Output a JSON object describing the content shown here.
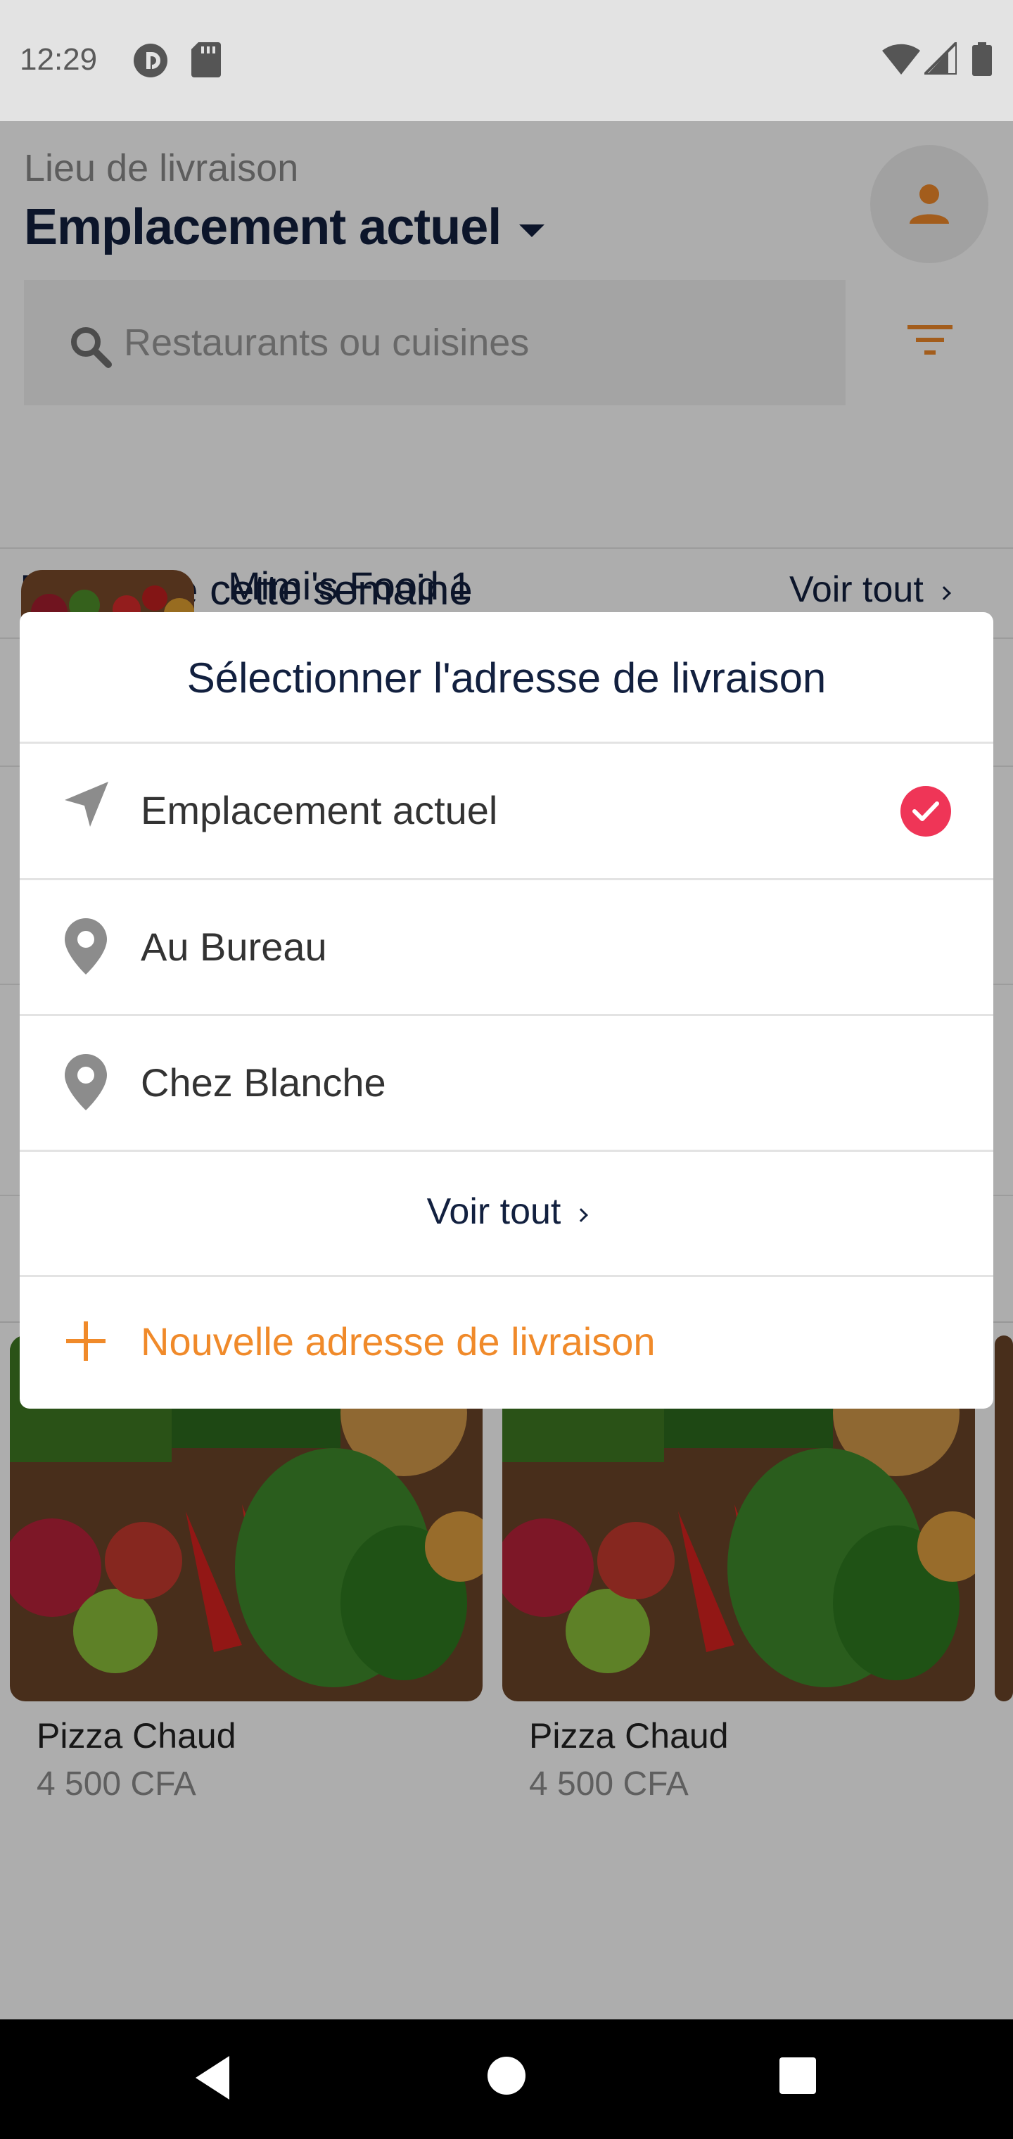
{
  "status_bar": {
    "time": "12:29"
  },
  "header": {
    "label": "Lieu de livraison",
    "title": "Emplacement actuel",
    "search_placeholder": "Restaurants ou cuisines"
  },
  "popular": {
    "title": "Populaire cette semaine",
    "see_all": "Voir tout",
    "first_restaurant": "Mimi's Food 1"
  },
  "cards": [
    {
      "name": "Pizza Chaud",
      "price": "4 500 CFA"
    },
    {
      "name": "Pizza Chaud",
      "price": "4 500 CFA"
    }
  ],
  "dialog": {
    "title": "Sélectionner l'adresse de livraison",
    "options": [
      {
        "label": "Emplacement actuel",
        "icon": "navigation-arrow-icon",
        "selected": true
      },
      {
        "label": "Au Bureau",
        "icon": "location-pin-icon",
        "selected": false
      },
      {
        "label": "Chez Blanche",
        "icon": "location-pin-icon",
        "selected": false
      }
    ],
    "see_all": "Voir tout",
    "new_address": "Nouvelle adresse de livraison"
  },
  "colors": {
    "accent": "#f08a2a",
    "navy": "#12203f",
    "selected_check": "#ef3557"
  }
}
